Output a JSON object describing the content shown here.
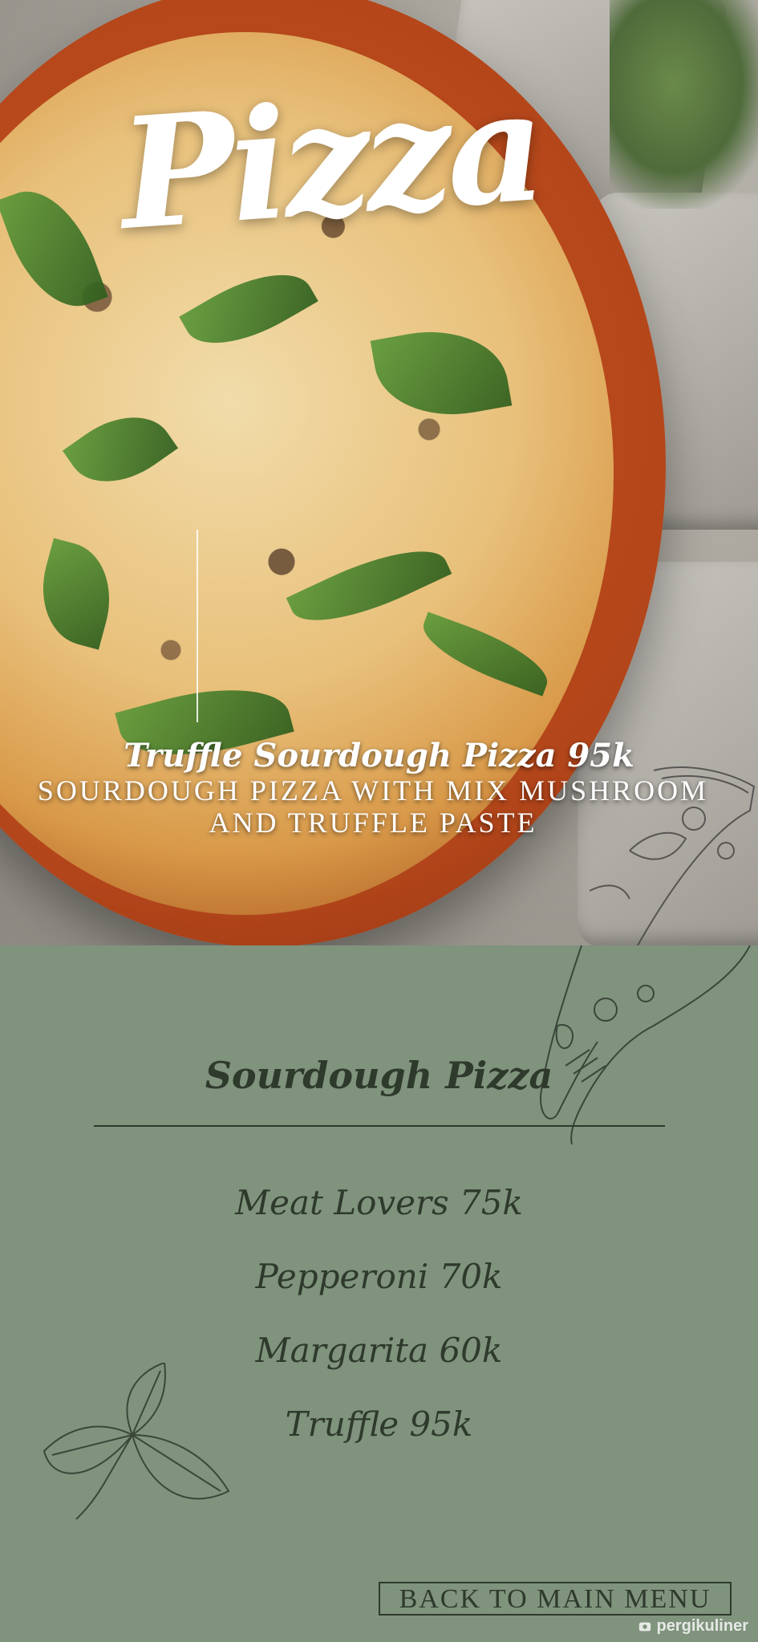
{
  "hero": {
    "title": "Pizza",
    "featured_name": "Truffle Sourdough Pizza 95k",
    "featured_desc": "SOURDOUGH PIZZA WITH MIX MUSHROOM AND TRUFFLE PASTE"
  },
  "menu": {
    "section_title": "Sourdough Pizza",
    "items": [
      {
        "label": "Meat Lovers 75k"
      },
      {
        "label": "Pepperoni 70k"
      },
      {
        "label": "Margarita 60k"
      },
      {
        "label": "Truffle 95k"
      }
    ],
    "back_label": "BACK TO MAIN MENU"
  },
  "watermark": {
    "text": "pergikuliner",
    "icon": "pergikuliner-logo-icon"
  },
  "colors": {
    "panel": "#7f937d",
    "ink": "#2e3a2c",
    "plate": "#b2451a"
  },
  "icons": [
    "pizza-slice-sketch-icon",
    "basil-leaf-sketch-icon"
  ]
}
